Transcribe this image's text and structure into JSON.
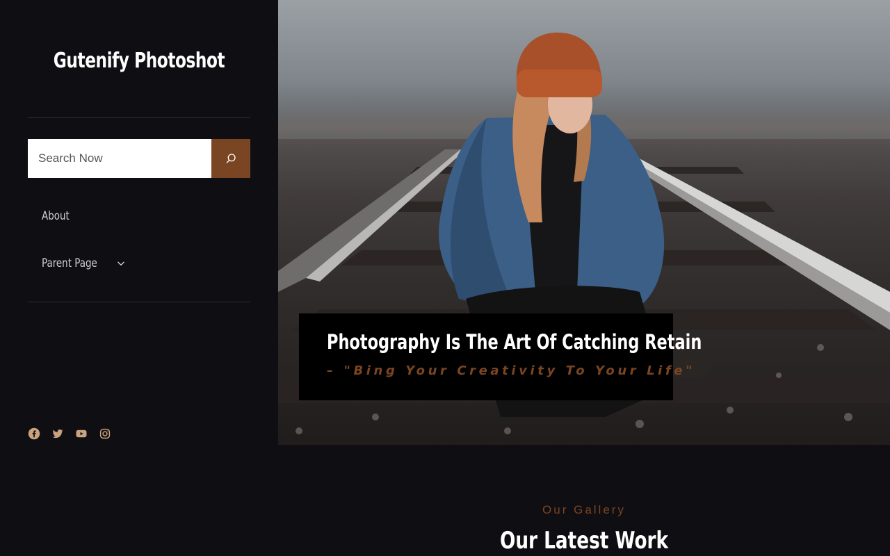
{
  "site": {
    "title": "Gutenify Photoshot"
  },
  "search": {
    "placeholder": "Search Now",
    "button_icon": "search-icon"
  },
  "nav": {
    "items": [
      {
        "label": "About"
      },
      {
        "label": "Parent Page",
        "has_submenu": true,
        "icon": "chevron-down-icon"
      }
    ]
  },
  "socials": [
    {
      "name": "facebook",
      "icon": "facebook-icon"
    },
    {
      "name": "twitter",
      "icon": "twitter-icon"
    },
    {
      "name": "youtube",
      "icon": "youtube-icon"
    },
    {
      "name": "instagram",
      "icon": "instagram-icon"
    }
  ],
  "hero": {
    "title": "Photography Is The Art Of Catching Retain",
    "quote": "– \"Bing Your Creativity To Your Life\""
  },
  "gallery": {
    "kicker": "Our Gallery",
    "heading": "Our Latest Work"
  },
  "colors": {
    "background": "#0f0e12",
    "accent": "#7a4523",
    "caption_bg": "#000000",
    "divider": "#2e2d33",
    "nav_text": "#cfcfd4",
    "social_icon": "#c9a27f"
  }
}
